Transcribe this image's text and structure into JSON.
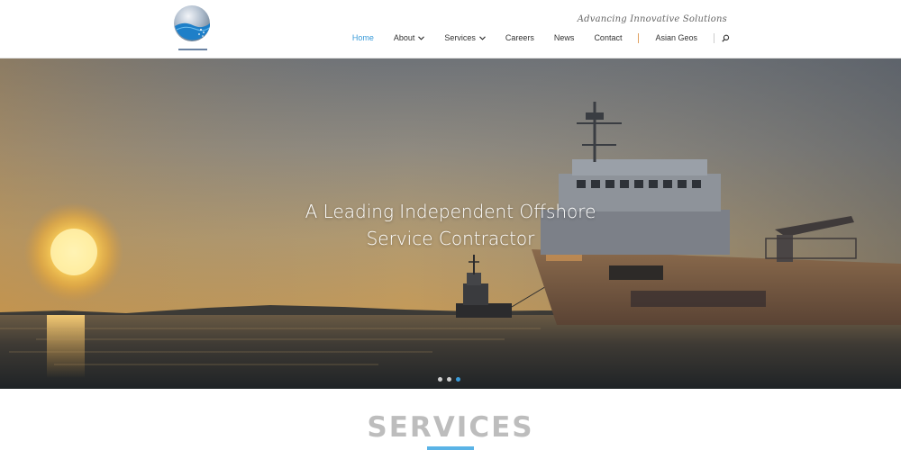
{
  "header": {
    "tagline": "Advancing Innovative Solutions",
    "nav": [
      {
        "label": "Home",
        "active": true,
        "dropdown": false
      },
      {
        "label": "About",
        "active": false,
        "dropdown": true
      },
      {
        "label": "Services",
        "active": false,
        "dropdown": true
      },
      {
        "label": "Careers",
        "active": false,
        "dropdown": false
      },
      {
        "label": "News",
        "active": false,
        "dropdown": false
      },
      {
        "label": "Contact",
        "active": false,
        "dropdown": false
      },
      {
        "label": "Asian Geos",
        "active": false,
        "dropdown": false
      }
    ],
    "icons": {
      "search": "search-icon",
      "chevron": "chevron-down-icon",
      "logo": "globe-logo"
    }
  },
  "hero": {
    "title_line1": "A Leading Independent Offshore",
    "title_line2": "Service Contractor",
    "slides": {
      "count": 3,
      "active_index": 2
    }
  },
  "services": {
    "title": "SERVICES"
  },
  "colors": {
    "accent": "#3a9bd9",
    "rule": "#5ab3e6",
    "heading_grey": "#bdbdbd",
    "separator": "#e0a060"
  }
}
